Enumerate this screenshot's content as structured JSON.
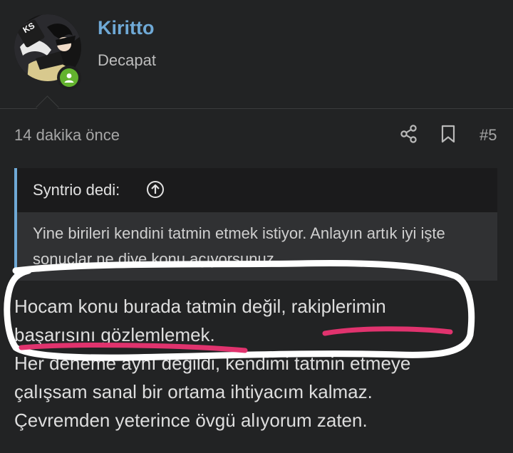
{
  "user": {
    "name": "Kiritto",
    "title": "Decapat",
    "avatar_badge": "KS",
    "online": true
  },
  "post": {
    "time": "14 dakika önce",
    "number": "#5",
    "quote": {
      "author": "Syntrio dedi:",
      "text": "Yine birileri kendini tatmin etmek istiyor. Anlayın artık iyi işte sonuçlar ne diye konu açıyorsunuz."
    },
    "lines": [
      "Hocam konu burada tatmin değil, rakiplerimin",
      "başarısını gözlemlemek.",
      "Her deneme aynı değildi, kendimi tatmin etmeye",
      "çalışsam sanal bir ortama ihtiyacım kalmaz.",
      "Çevremden yeterince övgü alıyorum zaten."
    ]
  },
  "colors": {
    "accent": "#6fa9d6",
    "online": "#63b32e",
    "annotation_circle": "#ffffff",
    "annotation_underline": "#e0336e"
  },
  "icons": [
    "share-icon",
    "bookmark-icon",
    "arrow-up-circle-icon",
    "user-icon"
  ]
}
